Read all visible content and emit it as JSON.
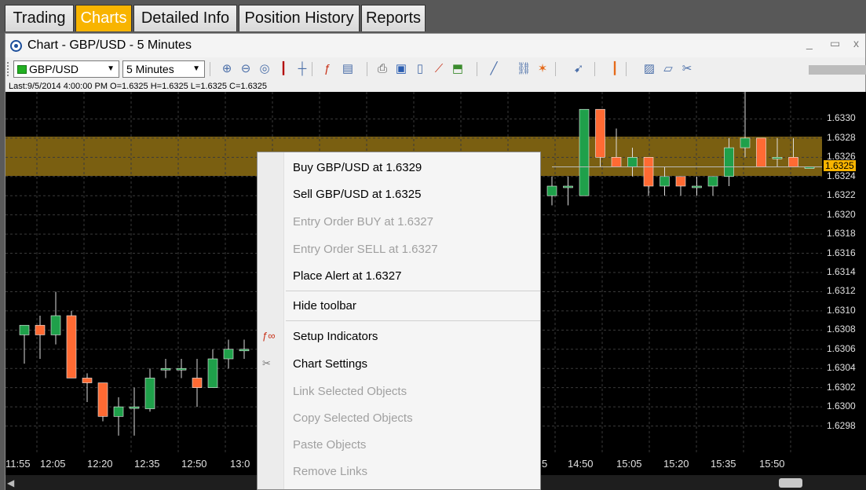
{
  "tabs": [
    "Trading",
    "Charts",
    "Detailed Info",
    "Position History",
    "Reports"
  ],
  "active_tab": "Charts",
  "window": {
    "title": "Chart - GBP/USD - 5 Minutes",
    "minimize": "_",
    "restore": "▭",
    "close": "x"
  },
  "toolbar": {
    "symbol": "GBP/USD",
    "timeframe": "5 Minutes",
    "icons": [
      "zoom-in-icon",
      "zoom-out-icon",
      "zoom-fit-icon",
      "cursor-icon",
      "crosshair-icon",
      "indicators-icon",
      "templates-icon",
      "print-icon",
      "save-icon",
      "document-icon",
      "line-chart-icon",
      "export-icon",
      "trend-line-icon",
      "link-icon",
      "fib-icon",
      "pointer-icon",
      "candle-icon",
      "screenshot-icon",
      "notes-icon",
      "settings-icon"
    ]
  },
  "info": "Last:9/5/2014 4:00:00 PM O=1.6325 H=1.6325 L=1.6325 C=1.6325",
  "colors": {
    "up": "#1fa04a",
    "down": "#ff6a33",
    "band": "#7a5f11",
    "accent": "#f8b400"
  },
  "chart_data": {
    "type": "candlestick",
    "y_ticks": [
      "1.6330",
      "1.6328",
      "1.6326",
      "1.6324",
      "1.6322",
      "1.6320",
      "1.6318",
      "1.6316",
      "1.6314",
      "1.6312",
      "1.6310",
      "1.6308",
      "1.6306",
      "1.6304",
      "1.6302",
      "1.6300",
      "1.6298"
    ],
    "ylim": [
      1.6296,
      1.6332
    ],
    "last_price_label": "1.6325",
    "x_ticks_left": [
      "11:55",
      "12:05",
      "12:20",
      "12:35",
      "12:50",
      "13:0"
    ],
    "x_ticks_right": [
      "5",
      "14:50",
      "15:05",
      "15:20",
      "15:35",
      "15:50"
    ],
    "candles_left": [
      [
        1.63075,
        1.63085,
        1.63085,
        1.63045
      ],
      [
        1.63085,
        1.63075,
        1.63095,
        1.6305
      ],
      [
        1.63075,
        1.63095,
        1.6312,
        1.63065
      ],
      [
        1.63095,
        1.6303,
        1.631,
        1.6303
      ],
      [
        1.6303,
        1.63025,
        1.63035,
        1.63005
      ],
      [
        1.63025,
        1.6299,
        1.63025,
        1.62985
      ],
      [
        1.6299,
        1.63,
        1.6301,
        1.6297
      ],
      [
        1.63,
        1.63,
        1.6302,
        1.6297
      ],
      [
        1.62998,
        1.6303,
        1.6304,
        1.62995
      ],
      [
        1.6304,
        1.6304,
        1.6305,
        1.6303
      ],
      [
        1.6304,
        1.6304,
        1.6305,
        1.6303
      ],
      [
        1.6303,
        1.6302,
        1.6305,
        1.63
      ],
      [
        1.6302,
        1.6305,
        1.6306,
        1.6302
      ],
      [
        1.6305,
        1.6306,
        1.6307,
        1.6304
      ],
      [
        1.6306,
        1.6306,
        1.6307,
        1.6305
      ]
    ],
    "candles_right": [
      [
        1.6322,
        1.6323,
        1.6324,
        1.6321
      ],
      [
        1.6323,
        1.6323,
        1.6324,
        1.6321
      ],
      [
        1.6322,
        1.6331,
        1.6331,
        1.6322
      ],
      [
        1.6331,
        1.6326,
        1.6331,
        1.6325
      ],
      [
        1.6326,
        1.6325,
        1.6329,
        1.6325
      ],
      [
        1.6325,
        1.6326,
        1.6327,
        1.6324
      ],
      [
        1.6326,
        1.6323,
        1.6326,
        1.6322
      ],
      [
        1.6323,
        1.6324,
        1.6325,
        1.6322
      ],
      [
        1.6324,
        1.6323,
        1.6324,
        1.6322
      ],
      [
        1.6323,
        1.6323,
        1.6324,
        1.6322
      ],
      [
        1.6323,
        1.6324,
        1.6324,
        1.6322
      ],
      [
        1.6324,
        1.6327,
        1.6328,
        1.6323
      ],
      [
        1.6327,
        1.6328,
        1.6333,
        1.6326
      ],
      [
        1.6328,
        1.6325,
        1.6328,
        1.6325
      ],
      [
        1.6326,
        1.6326,
        1.6328,
        1.6325
      ],
      [
        1.6326,
        1.6325,
        1.6328,
        1.6325
      ],
      [
        1.6325,
        1.6325,
        1.6325,
        1.6325
      ]
    ]
  },
  "menu": {
    "items": [
      {
        "label": "Buy GBP/USD at 1.6329",
        "enabled": true
      },
      {
        "label": "Sell GBP/USD at 1.6325",
        "enabled": true
      },
      {
        "label": "Entry Order BUY at 1.6327",
        "enabled": false
      },
      {
        "label": "Entry Order SELL at 1.6327",
        "enabled": false
      },
      {
        "label": "Place Alert at 1.6327",
        "enabled": true
      },
      {
        "label": "Hide toolbar",
        "enabled": true
      },
      {
        "label": "Setup Indicators",
        "enabled": true,
        "icon": "f(x)"
      },
      {
        "label": "Chart Settings",
        "enabled": true,
        "icon": "settings"
      },
      {
        "label": "Link Selected Objects",
        "enabled": false
      },
      {
        "label": "Copy Selected Objects",
        "enabled": false
      },
      {
        "label": "Paste Objects",
        "enabled": false
      },
      {
        "label": "Remove Links",
        "enabled": false
      }
    ]
  }
}
